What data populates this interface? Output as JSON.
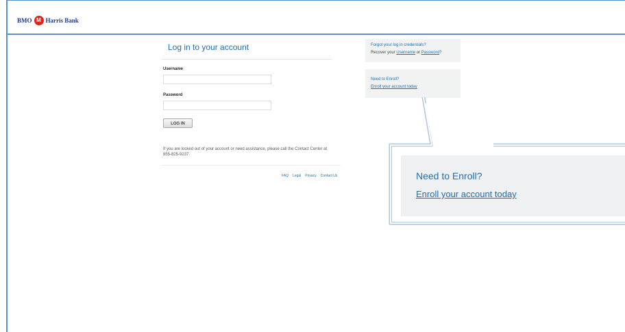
{
  "header": {
    "brand_left": "BMO",
    "brand_right": "Harris Bank",
    "roundel_glyph": "M"
  },
  "login": {
    "title": "Log in to your account",
    "username_label": "Username",
    "username_value": "",
    "password_label": "Password",
    "password_value": "",
    "login_button": "LOG IN",
    "assistance_text": "If you are locked out of your account or need assistance, please call the Contact Center at 855-825-9237."
  },
  "footer_links": [
    "FAQ",
    "Legal",
    "Privacy",
    "Contact Us"
  ],
  "forgot_box": {
    "title": "Forgot your log in credentials?",
    "recover_prefix": "Recover your ",
    "username_link": "Username",
    "or_text": " or ",
    "password_link": "Password",
    "suffix": "?"
  },
  "enroll_box": {
    "title": "Need to Enroll?",
    "link": "Enroll your account today"
  },
  "callout": {
    "title": "Need to Enroll?",
    "link": "Enroll your account today"
  },
  "colors": {
    "accent": "#1f6eb3",
    "frame": "#5b8fc9",
    "brand_red": "#e2231a",
    "panel_gray": "#f1f3f3"
  }
}
